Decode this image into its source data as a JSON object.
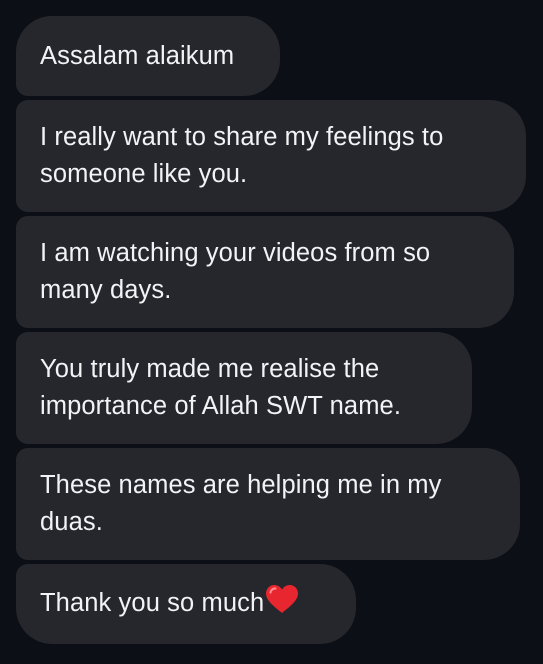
{
  "conversation": {
    "messages": [
      {
        "lines": [
          "Assalam alaikum"
        ]
      },
      {
        "lines": [
          "I really want to share my feelings to",
          "someone like you."
        ]
      },
      {
        "lines": [
          "I am watching your videos from so",
          "many days."
        ]
      },
      {
        "lines": [
          "You truly made me realise the",
          "importance of Allah SWT name."
        ]
      },
      {
        "lines": [
          "These names are helping me in my",
          "duas."
        ]
      },
      {
        "lines": [
          "Thank you so much"
        ],
        "emoji": "red-heart-icon"
      }
    ]
  },
  "colors": {
    "background": "#0c0f15",
    "bubble": "#25272d",
    "text": "#f2f3f5",
    "heart": "#e8262f"
  }
}
